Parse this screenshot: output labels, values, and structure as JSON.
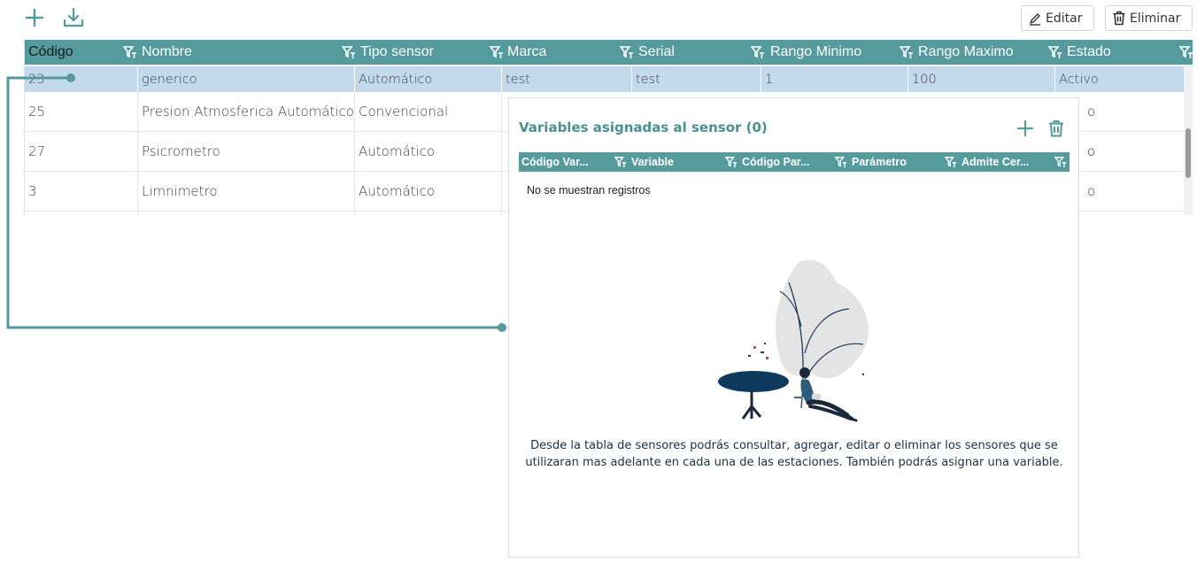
{
  "toolbar": {
    "add_icon": "plus-icon",
    "export_icon": "download-icon",
    "edit_label": "Editar",
    "delete_label": "Eliminar"
  },
  "colors": {
    "accent": "#559a9c",
    "header_text": "#ffffff",
    "selected_row": "#c3d9ec",
    "panel_title": "#4a8f93",
    "description_text": "#1f2f44"
  },
  "table": {
    "columns": [
      "Código",
      "Nombre",
      "Tipo sensor",
      "Marca",
      "Serial",
      "Rango Minimo",
      "Rango Maximo",
      "Estado"
    ],
    "rows": [
      [
        "23",
        "generico",
        "Automático",
        "test",
        "test",
        "1",
        "100",
        "Activo"
      ],
      [
        "25",
        "Presion Atmosferica Automático",
        "Convencional",
        "",
        "",
        "",
        "",
        "o"
      ],
      [
        "27",
        "Psicrometro",
        "Automático",
        "",
        "",
        "",
        "",
        "o"
      ],
      [
        "3",
        "Limnimetro",
        "Automático",
        "",
        "",
        "",
        "",
        "o"
      ]
    ]
  },
  "detail_panel": {
    "title": "Variables asignadas al sensor (0)",
    "add_icon": "plus-icon",
    "delete_icon": "trash-icon",
    "columns": [
      "Código Var...",
      "Variable",
      "Código Par...",
      "Parámetro",
      "Admite Cer..."
    ],
    "empty_message": "No se muestran registros",
    "description": "Desde la tabla de sensores podrás consultar, agregar, editar o eliminar los sensores que se utilizaran mas adelante en cada una de las estaciones. También podrás asignar una variable."
  }
}
